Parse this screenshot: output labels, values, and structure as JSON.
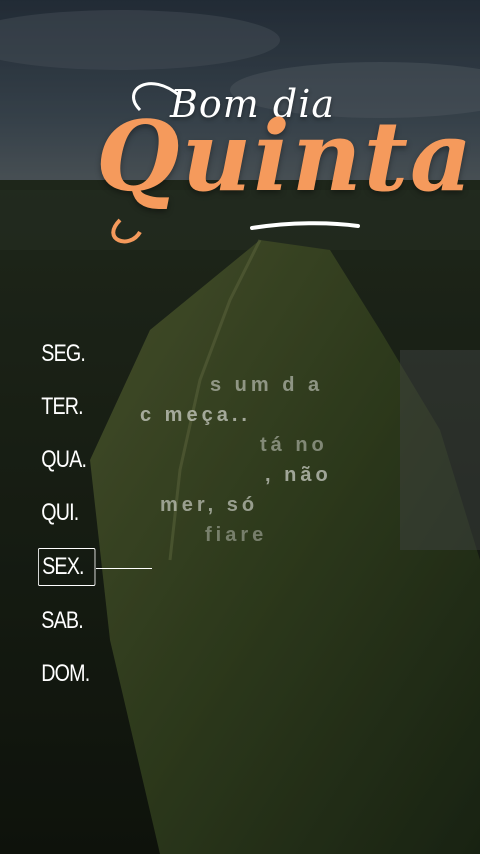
{
  "header": {
    "greeting": "Bom dia",
    "day_title": "Quinta"
  },
  "days": [
    {
      "label": "SEG."
    },
    {
      "label": "TER."
    },
    {
      "label": "QUA."
    },
    {
      "label": "QUI."
    },
    {
      "label": "SEX.",
      "active": true
    },
    {
      "label": "SAB."
    },
    {
      "label": "DOM."
    }
  ],
  "message_lines": [
    "s um d  a",
    "c  meça..",
    "tá no",
    ", não",
    "mer, só",
    "fiare"
  ],
  "colors": {
    "accent": "#f59a5c",
    "text": "#ffffff"
  }
}
